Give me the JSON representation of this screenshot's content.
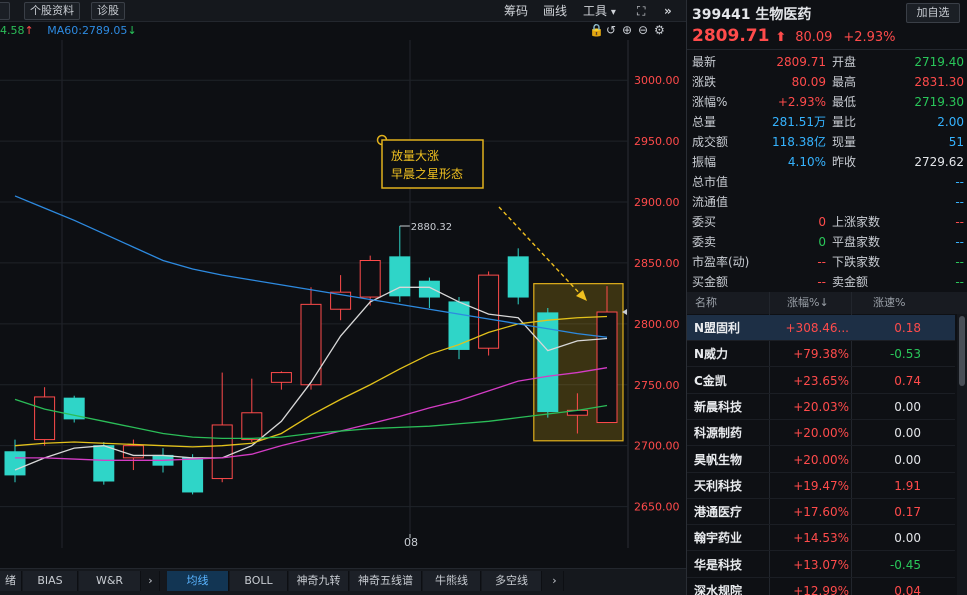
{
  "toolbar": {
    "left_buttons": [
      "个股资料",
      "诊股"
    ],
    "right_items": [
      "筹码",
      "画线",
      "工具"
    ],
    "chevron_symbol": "▾",
    "compress_symbol": "⛶",
    "expand_symbol": "»"
  },
  "ma": {
    "ma_partial": "4.58",
    "ma_partial_arrow": "↑",
    "ma60": "MA60:2789.05",
    "ma60_arrow": "↓"
  },
  "chart_controls": [
    "🔒",
    "↺",
    "⊕",
    "⊖",
    "⚙"
  ],
  "chart_data": {
    "type": "candlestick",
    "y_ticks": [
      3000,
      2950,
      2900,
      2850,
      2800,
      2750,
      2700,
      2650
    ],
    "y_tick_labels": [
      "3000.00",
      "2950.00",
      "2900.00",
      "2850.00",
      "2800.00",
      "2750.00",
      "2700.00",
      "2650.00"
    ],
    "ylim": [
      2616,
      3033
    ],
    "x_label": "08",
    "high_marker": "2880.32",
    "current_price_marker": 2809.71,
    "annotation": [
      "放量大涨",
      "早晨之星形态"
    ],
    "candles": [
      {
        "o": 2695,
        "c": 2676,
        "h": 2705,
        "l": 2670
      },
      {
        "o": 2705,
        "c": 2740,
        "h": 2748,
        "l": 2700
      },
      {
        "o": 2739,
        "c": 2722,
        "h": 2741,
        "l": 2719
      },
      {
        "o": 2700,
        "c": 2671,
        "h": 2703,
        "l": 2668
      },
      {
        "o": 2690,
        "c": 2700,
        "h": 2705,
        "l": 2680
      },
      {
        "o": 2692,
        "c": 2684,
        "h": 2698,
        "l": 2678
      },
      {
        "o": 2690,
        "c": 2662,
        "h": 2693,
        "l": 2660
      },
      {
        "o": 2673,
        "c": 2717,
        "h": 2760,
        "l": 2670
      },
      {
        "o": 2705,
        "c": 2727,
        "h": 2755,
        "l": 2703
      },
      {
        "o": 2752,
        "c": 2760,
        "h": 2761,
        "l": 2746
      },
      {
        "o": 2750,
        "c": 2816,
        "h": 2830,
        "l": 2746
      },
      {
        "o": 2812,
        "c": 2826,
        "h": 2840,
        "l": 2803
      },
      {
        "o": 2822,
        "c": 2852,
        "h": 2856,
        "l": 2815
      },
      {
        "o": 2855,
        "c": 2823,
        "h": 2880.32,
        "l": 2818
      },
      {
        "o": 2835,
        "c": 2822,
        "h": 2838,
        "l": 2813
      },
      {
        "o": 2818,
        "c": 2779,
        "h": 2822,
        "l": 2771
      },
      {
        "o": 2780,
        "c": 2840,
        "h": 2843,
        "l": 2774
      },
      {
        "o": 2855,
        "c": 2822,
        "h": 2862,
        "l": 2816
      },
      {
        "o": 2809,
        "c": 2728,
        "h": 2813,
        "l": 2723
      },
      {
        "o": 2725,
        "c": 2729,
        "h": 2743,
        "l": 2710
      },
      {
        "o": 2719,
        "c": 2809.71,
        "h": 2831,
        "l": 2719
      }
    ],
    "ma_lines": [
      {
        "name": "MA5",
        "color": "#d8d8d8",
        "values": [
          2680,
          2690,
          2698,
          2700,
          2692,
          2692,
          2690,
          2690,
          2700,
          2720,
          2752,
          2790,
          2818,
          2830,
          2830,
          2818,
          2808,
          2805,
          2778,
          2786,
          2788
        ]
      },
      {
        "name": "MA10",
        "color": "#e3c21b",
        "values": [
          2700,
          2702,
          2703,
          2702,
          2701,
          2700,
          2699,
          2700,
          2702,
          2710,
          2725,
          2738,
          2750,
          2763,
          2775,
          2783,
          2793,
          2800,
          2803,
          2805,
          2806
        ]
      },
      {
        "name": "MA20",
        "color": "#d43cc5",
        "values": [
          2690,
          2690,
          2689,
          2688,
          2688,
          2688,
          2689,
          2690,
          2693,
          2700,
          2706,
          2712,
          2718,
          2724,
          2731,
          2737,
          2745,
          2753,
          2757,
          2760,
          2764
        ]
      },
      {
        "name": "MA30",
        "color": "#2bbd58",
        "values": [
          2738,
          2730,
          2725,
          2720,
          2715,
          2710,
          2707,
          2706,
          2706,
          2707,
          2710,
          2712,
          2714,
          2715,
          2716,
          2718,
          2720,
          2723,
          2726,
          2729,
          2733
        ]
      },
      {
        "name": "MA60",
        "color": "#2d8ae0",
        "values": [
          2905,
          2895,
          2885,
          2874,
          2863,
          2852,
          2845,
          2840,
          2836,
          2832,
          2828,
          2824,
          2820,
          2816,
          2812,
          2808,
          2804,
          2800,
          2796,
          2792,
          2789
        ]
      }
    ]
  },
  "bottom_tabs": {
    "left": [
      "绪",
      "BIAS",
      "W&R",
      "›"
    ],
    "right": [
      "均线",
      "BOLL",
      "神奇九转",
      "神奇五线谱",
      "牛熊线",
      "多空线",
      "›"
    ]
  },
  "panel": {
    "code_name": "399441  生物医药",
    "add_button": "加自选",
    "price": "2809.71",
    "price_arrow": "⬆",
    "change": "80.09",
    "change_pct": "+2.93%",
    "quote_rows": [
      {
        "l": "最新",
        "v": "2809.71",
        "vc": "red",
        "l2": "开盘",
        "v2": "2719.40",
        "v2c": "green"
      },
      {
        "l": "涨跌",
        "v": "80.09",
        "vc": "red",
        "l2": "最高",
        "v2": "2831.30",
        "v2c": "red"
      },
      {
        "l": "涨幅%",
        "v": "+2.93%",
        "vc": "red",
        "l2": "最低",
        "v2": "2719.30",
        "v2c": "green"
      },
      {
        "l": "总量",
        "v": "281.51万",
        "vc": "cyan",
        "l2": "量比",
        "v2": "2.00",
        "v2c": "cyan"
      },
      {
        "l": "成交额",
        "v": "118.38亿",
        "vc": "cyan",
        "l2": "现量",
        "v2": "51",
        "v2c": "cyan"
      },
      {
        "l": "振幅",
        "v": "4.10%",
        "vc": "cyan",
        "l2": "昨收",
        "v2": "2729.62",
        "v2c": "white"
      },
      {
        "l": "总市值",
        "v": "",
        "vc": "white",
        "l2": "",
        "v2": "--",
        "v2c": "cyan"
      },
      {
        "l": "流通值",
        "v": "",
        "vc": "white",
        "l2": "",
        "v2": "--",
        "v2c": "cyan"
      },
      {
        "l": "委买",
        "v": "0",
        "vc": "red",
        "l2": "上涨家数",
        "v2": "--",
        "v2c": "red"
      },
      {
        "l": "委卖",
        "v": "0",
        "vc": "green",
        "l2": "平盘家数",
        "v2": "--",
        "v2c": "cyan"
      },
      {
        "l": "市盈率(动)",
        "v": "--",
        "vc": "red",
        "l2": "下跌家数",
        "v2": "--",
        "v2c": "green"
      },
      {
        "l": "买金额",
        "v": "--",
        "vc": "red",
        "l2": "卖金额",
        "v2": "--",
        "v2c": "green"
      }
    ],
    "list_headers": [
      "名称",
      "涨幅%↓",
      "涨速%"
    ],
    "list": [
      {
        "name": "N盟固利",
        "chg": "+308.46...",
        "spd": "0.18",
        "sc": "red"
      },
      {
        "name": "N威力",
        "chg": "+79.38%",
        "spd": "-0.53",
        "sc": "green"
      },
      {
        "name": "C金凯",
        "chg": "+23.65%",
        "spd": "0.74",
        "sc": "red"
      },
      {
        "name": "新晨科技",
        "chg": "+20.03%",
        "spd": "0.00",
        "sc": "white"
      },
      {
        "name": "科源制药",
        "chg": "+20.00%",
        "spd": "0.00",
        "sc": "white"
      },
      {
        "name": "昊帆生物",
        "chg": "+20.00%",
        "spd": "0.00",
        "sc": "white"
      },
      {
        "name": "天利科技",
        "chg": "+19.47%",
        "spd": "1.91",
        "sc": "red"
      },
      {
        "name": "港通医疗",
        "chg": "+17.60%",
        "spd": "0.17",
        "sc": "red"
      },
      {
        "name": "翰宇药业",
        "chg": "+14.53%",
        "spd": "0.00",
        "sc": "white"
      },
      {
        "name": "华是科技",
        "chg": "+13.07%",
        "spd": "-0.45",
        "sc": "green"
      },
      {
        "name": "深水规院",
        "chg": "+12.99%",
        "spd": "0.04",
        "sc": "red"
      }
    ]
  }
}
